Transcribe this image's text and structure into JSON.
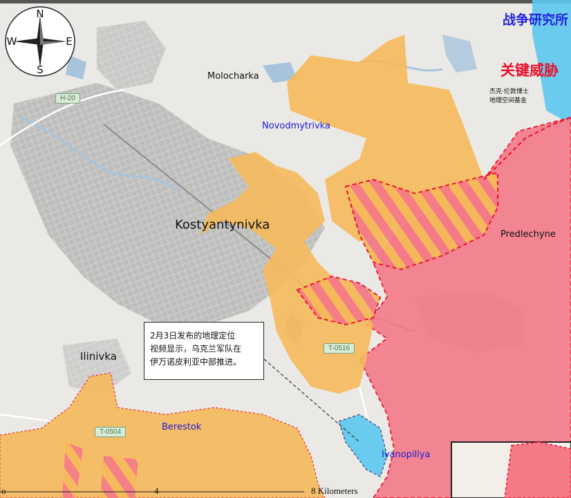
{
  "map": {
    "title_org": "战争研究所",
    "title_main": "关键威胁",
    "credit_line1": "杰克·伦敦博士",
    "credit_line2": "地理空间基金",
    "callout_lines": [
      "2月3日发布的地理定位",
      "视频显示，乌克兰军队在",
      "伊万诺皮利亚中部推进。"
    ],
    "places": {
      "molocharka": "Molocharka",
      "novodmytrivka": "Novodmytrivka",
      "kostyantynivka": "Kostyantynivka",
      "predlechyne": "Predlechyne",
      "ilinivka": "Ilinivka",
      "berestok": "Berestok",
      "ivanopillya": "Ivanopillya"
    },
    "roads": {
      "h20": "H-20",
      "t0516": "T-0516",
      "t0504": "T-0504"
    },
    "scale": {
      "left_num": "4",
      "right_label": "8 Kilometers",
      "partial": "o"
    },
    "compass": {
      "n": "N",
      "s": "S",
      "e": "E",
      "w": "W"
    },
    "colors": {
      "russian_advance": "#f6b95a",
      "russian_control": "#f47a88",
      "ukrainian_counter": "#5cc8f0",
      "frontline": "#e8102a",
      "urban": "#a9a9a9",
      "water": "#a8c4dc"
    }
  }
}
